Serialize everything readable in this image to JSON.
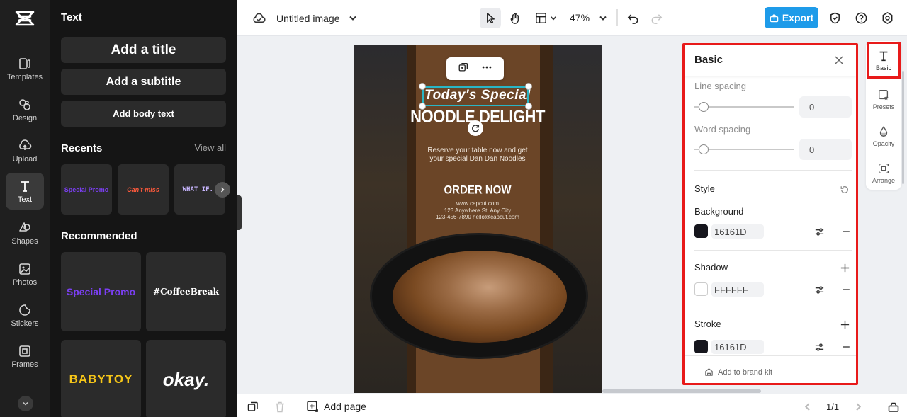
{
  "sidebar": {
    "items": [
      {
        "label": "Templates",
        "icon": "templates-icon"
      },
      {
        "label": "Design",
        "icon": "design-icon"
      },
      {
        "label": "Upload",
        "icon": "upload-icon"
      },
      {
        "label": "Text",
        "icon": "text-icon",
        "active": true
      },
      {
        "label": "Shapes",
        "icon": "shapes-icon"
      },
      {
        "label": "Photos",
        "icon": "photos-icon"
      },
      {
        "label": "Stickers",
        "icon": "stickers-icon"
      },
      {
        "label": "Frames",
        "icon": "frames-icon"
      }
    ]
  },
  "text_panel": {
    "title": "Text",
    "add_title": "Add a title",
    "add_subtitle": "Add a subtitle",
    "add_body": "Add body text",
    "recents_title": "Recents",
    "view_all": "View all",
    "recents": [
      {
        "label": "Special Promo",
        "color": "#7b3ff2"
      },
      {
        "label": "Can't-miss",
        "color": "#ff5a3c"
      },
      {
        "label": "WHAT IF..",
        "color": "#c8b6ff"
      }
    ],
    "recommended_title": "Recommended",
    "recommended": [
      {
        "label": "Special Promo",
        "color": "#7b3ff2"
      },
      {
        "label": "#CoffeeBreak",
        "color": "#ffffff"
      },
      {
        "label": "BABYTOY",
        "color": "#f5c518"
      },
      {
        "label": "okay.",
        "color": "#ffffff"
      }
    ]
  },
  "topbar": {
    "doc_title": "Untitled image",
    "zoom": "47%",
    "export_label": "Export"
  },
  "canvas": {
    "title": "Today's Special",
    "headline": "NOODLE DELIGHT",
    "reserve_line1": "Reserve your table now and get",
    "reserve_line2": "your special Dan Dan Noodles",
    "cta": "ORDER NOW",
    "contact_line1": "www.capcut.com",
    "contact_line2": "123 Anywhere St. Any City",
    "contact_line3": "123-456-7890 hello@capcut.com"
  },
  "properties": {
    "title": "Basic",
    "line_spacing_label": "Line spacing",
    "line_spacing_value": "0",
    "word_spacing_label": "Word spacing",
    "word_spacing_value": "0",
    "style_label": "Style",
    "background_label": "Background",
    "background_hex": "16161D",
    "background_color": "#16161d",
    "shadow_label": "Shadow",
    "shadow_hex": "FFFFFF",
    "shadow_color": "#ffffff",
    "stroke_label": "Stroke",
    "stroke_hex": "16161D",
    "stroke_color": "#16161d",
    "brand_kit": "Add to brand kit"
  },
  "mini_rail": {
    "items": [
      {
        "label": "Basic",
        "active": true
      },
      {
        "label": "Presets"
      },
      {
        "label": "Opacity"
      },
      {
        "label": "Arrange"
      }
    ]
  },
  "bottombar": {
    "add_page": "Add page",
    "page_indicator": "1/1"
  },
  "colors": {
    "accent": "#1e9be9",
    "highlight": "#e81a1a",
    "selection": "#29b6c6"
  }
}
